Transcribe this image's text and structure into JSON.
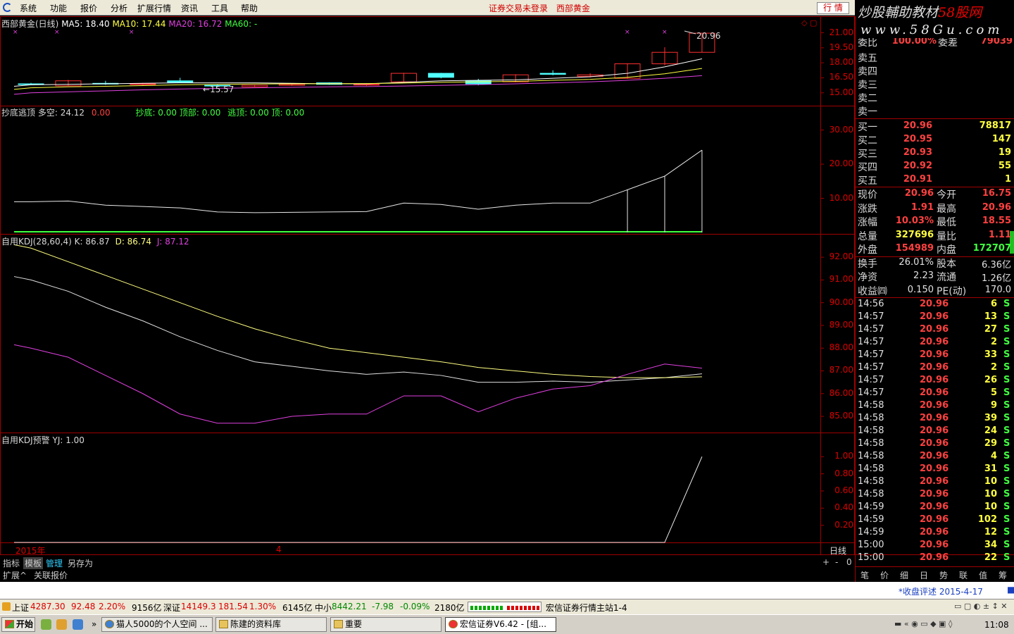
{
  "menu": {
    "items": [
      "系统",
      "功能",
      "报价",
      "分析",
      "扩展行情",
      "资讯",
      "工具",
      "帮助"
    ],
    "alert_login": "证券交易未登录",
    "stock_name": "西部黄金",
    "hq_button": "行 情"
  },
  "watermark": {
    "line1": "炒股輔助教材",
    "line1_red": "58股网",
    "line2": "www.58Gu.com"
  },
  "chart_data": [
    {
      "panel": "price",
      "type": "candlestick",
      "title": "西部黄金(日线)",
      "indicators": [
        {
          "name": "MA5",
          "value": "18.40",
          "color": "#ffffff"
        },
        {
          "name": "MA10",
          "value": "17.44",
          "color": "#ffff40"
        },
        {
          "name": "MA20",
          "value": "16.72",
          "color": "#e040e0"
        },
        {
          "name": "MA60",
          "value": "-",
          "color": "#40ff40"
        }
      ],
      "ylim": [
        14.0,
        21.6
      ],
      "yticks": [
        "21.00",
        "19.50",
        "18.00",
        "16.50",
        "15.00"
      ],
      "yticks_v": [
        21.0,
        19.5,
        18.0,
        16.5,
        15.0
      ],
      "candles": [
        {
          "o": 15.9,
          "h": 16.0,
          "l": 15.8,
          "c": 15.9,
          "up": false
        },
        {
          "o": 15.7,
          "h": 16.3,
          "l": 15.7,
          "c": 16.2,
          "up": true
        },
        {
          "o": 15.95,
          "h": 16.2,
          "l": 15.8,
          "c": 15.9,
          "up": false
        },
        {
          "o": 15.9,
          "h": 16.0,
          "l": 15.75,
          "c": 15.85,
          "up": true
        },
        {
          "o": 16.2,
          "h": 16.5,
          "l": 16.0,
          "c": 16.05,
          "up": false
        },
        {
          "o": 15.75,
          "h": 15.85,
          "l": 15.57,
          "c": 15.7,
          "up": false
        },
        {
          "o": 15.6,
          "h": 15.8,
          "l": 15.57,
          "c": 15.75,
          "up": true
        },
        {
          "o": 15.75,
          "h": 15.9,
          "l": 15.7,
          "c": 15.85,
          "up": true
        },
        {
          "o": 15.85,
          "h": 16.05,
          "l": 15.8,
          "c": 16.0,
          "up": false
        },
        {
          "o": 15.8,
          "h": 15.95,
          "l": 15.7,
          "c": 15.85,
          "up": true
        },
        {
          "o": 16.1,
          "h": 17.0,
          "l": 16.05,
          "c": 16.95,
          "up": true
        },
        {
          "o": 16.95,
          "h": 17.0,
          "l": 16.45,
          "c": 16.55,
          "up": false
        },
        {
          "o": 16.2,
          "h": 16.4,
          "l": 15.75,
          "c": 15.9,
          "up": false
        },
        {
          "o": 16.1,
          "h": 16.85,
          "l": 16.05,
          "c": 16.8,
          "up": true
        },
        {
          "o": 16.95,
          "h": 17.25,
          "l": 16.75,
          "c": 16.85,
          "up": false
        },
        {
          "o": 16.8,
          "h": 16.95,
          "l": 16.55,
          "c": 16.65,
          "up": true
        },
        {
          "o": 16.45,
          "h": 17.95,
          "l": 16.4,
          "c": 17.9,
          "up": true
        },
        {
          "o": 17.9,
          "h": 19.55,
          "l": 17.75,
          "c": 19.05,
          "up": true
        },
        {
          "o": 19.05,
          "h": 21.0,
          "l": 19.05,
          "c": 20.96,
          "up": true
        }
      ],
      "ma": [
        {
          "color": "#ffffff",
          "values": [
            15.8,
            15.85,
            15.9,
            15.95,
            16.0,
            16.0,
            16.0,
            15.95,
            15.9,
            15.9,
            16.05,
            16.2,
            16.25,
            16.3,
            16.45,
            16.6,
            16.95,
            17.6,
            18.4
          ]
        },
        {
          "color": "#ffff40",
          "values": [
            15.5,
            15.6,
            15.65,
            15.72,
            15.8,
            15.85,
            15.88,
            15.9,
            15.92,
            15.93,
            15.98,
            16.05,
            16.1,
            16.15,
            16.25,
            16.35,
            16.55,
            16.9,
            17.44
          ]
        },
        {
          "color": "#e040e0",
          "values": [
            15.0,
            15.1,
            15.2,
            15.3,
            15.38,
            15.45,
            15.5,
            15.55,
            15.6,
            15.63,
            15.68,
            15.75,
            15.82,
            15.9,
            16.0,
            16.1,
            16.25,
            16.45,
            16.72
          ]
        }
      ],
      "annotations": {
        "high": "20.96",
        "low": "15.57"
      }
    },
    {
      "panel": "chaodi",
      "type": "line",
      "title": "抄底逃顶",
      "labels": [
        {
          "text": "多空: 24.12",
          "color": "#d8d8d8"
        },
        {
          "text": "0.00",
          "color": "#ff4040"
        },
        {
          "text": "抄底: 0.00",
          "color": "#40ff40"
        },
        {
          "text": "顶部: 0.00",
          "color": "#40ff40"
        },
        {
          "text": "逃顶: 0.00",
          "color": "#40ff40"
        },
        {
          "text": "顶: 0.00",
          "color": "#40ff40"
        }
      ],
      "ylim": [
        0,
        33
      ],
      "yticks": [
        "30.00",
        "20.00",
        "10.00"
      ],
      "yticks_v": [
        30,
        20,
        10
      ],
      "values": [
        9.0,
        9.2,
        8.0,
        7.6,
        7.2,
        6.0,
        5.8,
        5.9,
        6.0,
        6.1,
        8.6,
        8.2,
        6.8,
        8.0,
        8.6,
        8.6,
        12.5,
        16.5,
        24.12
      ],
      "bars_from": 16
    },
    {
      "panel": "kdj",
      "type": "line",
      "title": "自用KDJ(28,60,4)",
      "labels": [
        {
          "text": "K: 86.87",
          "color": "#d8d8d8"
        },
        {
          "text": "D: 86.74",
          "color": "#ffff80"
        },
        {
          "text": "J: 87.12",
          "color": "#e040e0"
        }
      ],
      "ylim": [
        84.35,
        92.5
      ],
      "yticks": [
        "92.00",
        "91.00",
        "90.00",
        "89.00",
        "88.00",
        "87.00",
        "86.00",
        "85.00"
      ],
      "yticks_v": [
        92,
        91,
        90,
        89,
        88,
        87,
        86,
        85
      ],
      "series": [
        {
          "name": "K",
          "color": "#e0e0e0",
          "values": [
            91.0,
            90.5,
            89.8,
            89.2,
            88.5,
            87.9,
            87.4,
            87.2,
            87.0,
            86.85,
            86.95,
            86.8,
            86.5,
            86.5,
            86.55,
            86.5,
            86.6,
            86.7,
            86.87
          ]
        },
        {
          "name": "D",
          "color": "#ffff80",
          "values": [
            92.4,
            91.8,
            91.2,
            90.6,
            90.0,
            89.4,
            88.85,
            88.4,
            88.0,
            87.8,
            87.6,
            87.4,
            87.15,
            87.0,
            86.85,
            86.75,
            86.7,
            86.7,
            86.74
          ]
        },
        {
          "name": "J",
          "color": "#e040e0",
          "values": [
            88.0,
            87.6,
            86.8,
            86.0,
            85.1,
            84.7,
            84.7,
            85.0,
            85.1,
            85.1,
            85.9,
            85.9,
            85.2,
            85.8,
            86.2,
            86.35,
            86.85,
            87.3,
            87.12
          ]
        }
      ]
    },
    {
      "panel": "yujing",
      "type": "line",
      "title": "自用KDJ预警",
      "labels": [
        {
          "text": "YJ: 1.00",
          "color": "#d8d8d8"
        }
      ],
      "ylim": [
        0,
        1.15
      ],
      "yticks": [
        "1.00",
        "0.80",
        "0.60",
        "0.40",
        "0.20"
      ],
      "yticks_v": [
        1.0,
        0.8,
        0.6,
        0.4,
        0.2
      ],
      "values": [
        0,
        0,
        0,
        0,
        0,
        0,
        0,
        0,
        0,
        0,
        0,
        0,
        0,
        0,
        0,
        0,
        0,
        0,
        1.0
      ]
    }
  ],
  "xaxis": {
    "year": "2015年",
    "month": "4",
    "period": "日线"
  },
  "bottom_tabs": {
    "row1": [
      "指标",
      "模板",
      "管理",
      "另存为"
    ],
    "row2": [
      "扩展^",
      "关联报价"
    ],
    "zoom": [
      "+",
      "-",
      "0"
    ]
  },
  "orderbook": {
    "header": {
      "l1": "委比",
      "v1": "100.00%",
      "l2": "委差",
      "v2": "79039"
    },
    "asks": [
      {
        "label": "卖五"
      },
      {
        "label": "卖四"
      },
      {
        "label": "卖三"
      },
      {
        "label": "卖二"
      },
      {
        "label": "卖一"
      }
    ],
    "bids": [
      {
        "label": "买一",
        "price": "20.96",
        "vol": "78817"
      },
      {
        "label": "买二",
        "price": "20.95",
        "vol": "147"
      },
      {
        "label": "买三",
        "price": "20.93",
        "vol": "19"
      },
      {
        "label": "买四",
        "price": "20.92",
        "vol": "55"
      },
      {
        "label": "买五",
        "price": "20.91",
        "vol": "1"
      }
    ]
  },
  "quote": [
    {
      "l1": "现价",
      "v1": "20.96",
      "c1": "r",
      "l2": "今开",
      "v2": "16.75",
      "c2": "r"
    },
    {
      "l1": "涨跌",
      "v1": "1.91",
      "c1": "r",
      "l2": "最高",
      "v2": "20.96",
      "c2": "r"
    },
    {
      "l1": "涨幅",
      "v1": "10.03%",
      "c1": "r",
      "l2": "最低",
      "v2": "18.55",
      "c2": "r"
    },
    {
      "l1": "总量",
      "v1": "327696",
      "c1": "y",
      "l2": "量比",
      "v2": "1.11",
      "c2": "r"
    },
    {
      "l1": "外盘",
      "v1": "154989",
      "c1": "r",
      "l2": "内盘",
      "v2": "172707",
      "c2": "g"
    },
    {
      "l1": "换手",
      "v1": "26.01%",
      "c1": "w",
      "l2": "股本",
      "v2": "6.36亿",
      "c2": "w"
    },
    {
      "l1": "净资",
      "v1": "2.23",
      "c1": "w",
      "l2": "流通",
      "v2": "1.26亿",
      "c2": "w"
    },
    {
      "l1": "收益㈣",
      "v1": "0.150",
      "c1": "w",
      "l2": "PE(动)",
      "v2": "170.0",
      "c2": "w"
    }
  ],
  "ticks": [
    {
      "time": "14:56",
      "price": "20.96",
      "vol": "6",
      "side": "S"
    },
    {
      "time": "14:57",
      "price": "20.96",
      "vol": "13",
      "side": "S"
    },
    {
      "time": "14:57",
      "price": "20.96",
      "vol": "27",
      "side": "S"
    },
    {
      "time": "14:57",
      "price": "20.96",
      "vol": "2",
      "side": "S"
    },
    {
      "time": "14:57",
      "price": "20.96",
      "vol": "33",
      "side": "S"
    },
    {
      "time": "14:57",
      "price": "20.96",
      "vol": "2",
      "side": "S"
    },
    {
      "time": "14:57",
      "price": "20.96",
      "vol": "26",
      "side": "S"
    },
    {
      "time": "14:57",
      "price": "20.96",
      "vol": "5",
      "side": "S"
    },
    {
      "time": "14:58",
      "price": "20.96",
      "vol": "9",
      "side": "S"
    },
    {
      "time": "14:58",
      "price": "20.96",
      "vol": "39",
      "side": "S"
    },
    {
      "time": "14:58",
      "price": "20.96",
      "vol": "24",
      "side": "S"
    },
    {
      "time": "14:58",
      "price": "20.96",
      "vol": "29",
      "side": "S"
    },
    {
      "time": "14:58",
      "price": "20.96",
      "vol": "4",
      "side": "S"
    },
    {
      "time": "14:58",
      "price": "20.96",
      "vol": "31",
      "side": "S"
    },
    {
      "time": "14:58",
      "price": "20.96",
      "vol": "10",
      "side": "S"
    },
    {
      "time": "14:58",
      "price": "20.96",
      "vol": "10",
      "side": "S"
    },
    {
      "time": "14:59",
      "price": "20.96",
      "vol": "10",
      "side": "S"
    },
    {
      "time": "14:59",
      "price": "20.96",
      "vol": "102",
      "side": "S"
    },
    {
      "time": "14:59",
      "price": "20.96",
      "vol": "12",
      "side": "S"
    },
    {
      "time": "15:00",
      "price": "20.96",
      "vol": "34",
      "side": "S"
    },
    {
      "time": "15:00",
      "price": "20.96",
      "vol": "22",
      "side": "S"
    }
  ],
  "right_tabs": [
    "笔",
    "价",
    "细",
    "日",
    "势",
    "联",
    "值",
    "筹"
  ],
  "news": {
    "text": "*收盘评述 2015-4-17"
  },
  "status": {
    "sh_label": "上证",
    "sh_val": "4287.30",
    "sh_chg": "92.48",
    "sh_pct": "2.20%",
    "sh_amt": "9156亿",
    "sz_label": "深证",
    "sz_val": "14149.3",
    "sz_chg": "181.54",
    "sz_pct": "1.30%",
    "sz_amt": "6145亿",
    "zx_label": "中小",
    "zx_val": "8442.21",
    "zx_chg": "-7.98",
    "zx_pct": "-0.09%",
    "zx_amt": "2180亿",
    "server": "宏信证券行情主站1-4"
  },
  "taskbar": {
    "start": "开始",
    "items": [
      "猫人5000的个人空间 ...",
      "陈建的资料库",
      "重要",
      "宏信证券V6.42 - [组..."
    ],
    "clock": "11:08"
  }
}
